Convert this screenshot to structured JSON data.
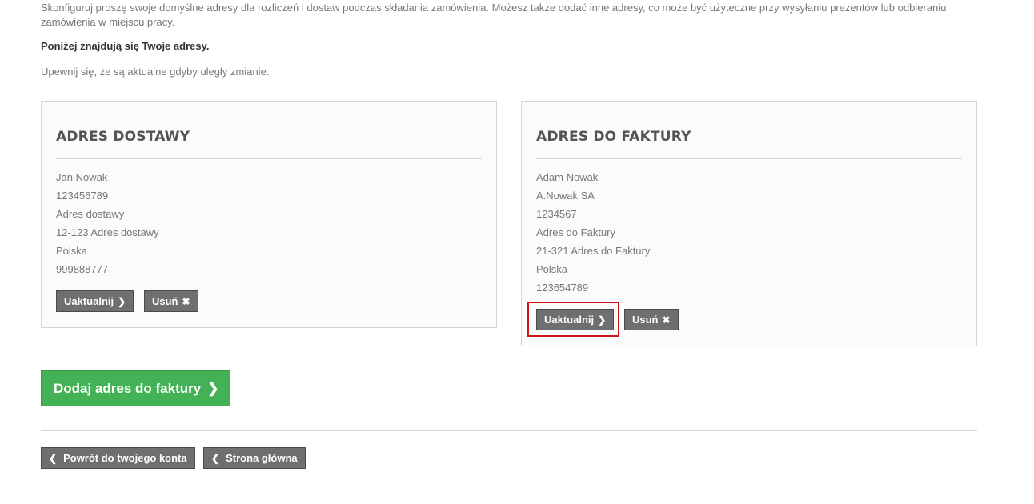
{
  "intro": {
    "text": "Skonfiguruj proszę swoje domyślne adresy dla rozliczeń i dostaw podczas składania zamówienia. Możesz także dodać inne adresy, co może być użyteczne przy wysyłaniu prezentów lub odbieraniu zamówienia w miejscu pracy.",
    "bold_note": "Poniżej znajdują się Twoje adresy.",
    "sub_note": "Upewnij się, że są aktualne gdyby uległy zmianie."
  },
  "delivery": {
    "title": "ADRES DOSTAWY",
    "lines": [
      "Jan Nowak",
      "123456789",
      "Adres dostawy",
      "12-123 Adres dostawy",
      "Polska",
      "999888777"
    ],
    "update_label": "Uaktualnij",
    "delete_label": "Usuń"
  },
  "invoice": {
    "title": "ADRES DO FAKTURY",
    "lines": [
      "Adam Nowak",
      "A.Nowak SA",
      "1234567",
      "Adres do Faktury",
      "21-321 Adres do Faktury",
      "Polska",
      "123654789"
    ],
    "update_label": "Uaktualnij",
    "delete_label": "Usuń"
  },
  "add_address_label": "Dodaj adres do faktury",
  "footer": {
    "back_label": "Powrót do twojego konta",
    "home_label": "Strona główna"
  },
  "icons": {
    "chevron_right": "chevron-right-icon",
    "chevron_left": "chevron-left-icon",
    "close": "close-icon"
  },
  "colors": {
    "primary_green": "#43b155",
    "dark_button": "#6f6f6f",
    "highlight_red": "#d0121b"
  }
}
